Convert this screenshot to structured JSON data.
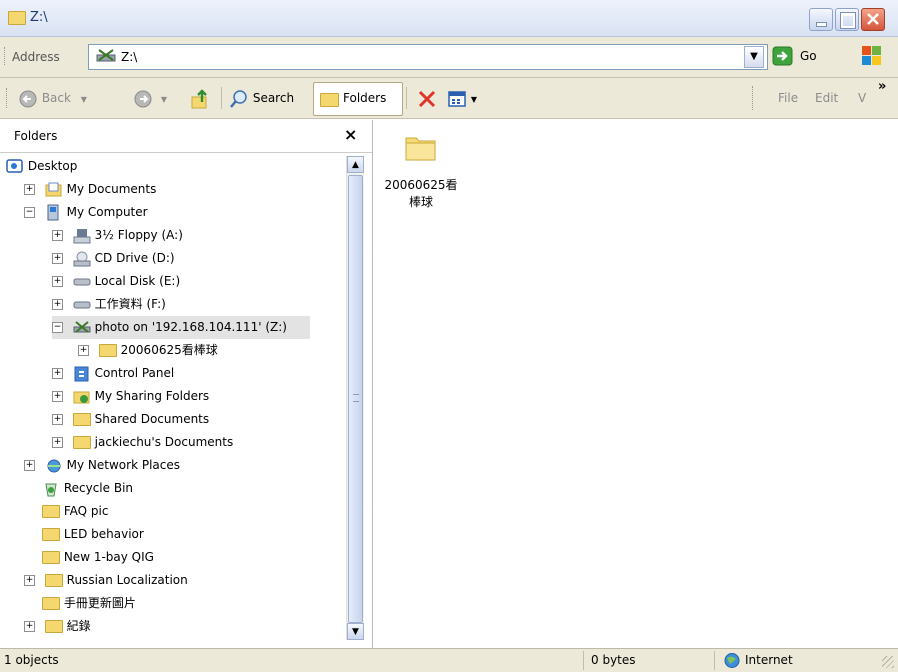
{
  "window": {
    "title": "Z:\\"
  },
  "address": {
    "label": "Address",
    "value": "Z:\\",
    "go_label": "Go"
  },
  "toolbar": {
    "back_label": "Back",
    "search_label": "Search",
    "folders_label": "Folders",
    "menu_file": "File",
    "menu_edit": "Edit",
    "menu_view": "V",
    "more_glyph": "»"
  },
  "folders_pane": {
    "title": "Folders",
    "close_glyph": "×",
    "items": [
      {
        "label": "Desktop",
        "icon": "desktop-icon"
      },
      {
        "label": "My Documents",
        "icon": "my-documents-icon",
        "expander": "+"
      },
      {
        "label": "My Computer",
        "icon": "my-computer-icon",
        "expander": "−"
      },
      {
        "label": "3½ Floppy (A:)",
        "icon": "floppy-icon",
        "expander": "+"
      },
      {
        "label": "CD Drive (D:)",
        "icon": "cd-drive-icon",
        "expander": "+"
      },
      {
        "label": "Local Disk (E:)",
        "icon": "hard-disk-icon",
        "expander": "+"
      },
      {
        "label": "工作資料 (F:)",
        "icon": "hard-disk-icon",
        "expander": "+"
      },
      {
        "label": "photo on '192.168.104.111' (Z:)",
        "icon": "network-drive-icon",
        "expander": "−"
      },
      {
        "label": "20060625看棒球",
        "icon": "folder-icon",
        "expander": "+"
      },
      {
        "label": "Control Panel",
        "icon": "control-panel-icon",
        "expander": "+"
      },
      {
        "label": "My Sharing Folders",
        "icon": "sharing-folders-icon",
        "expander": "+"
      },
      {
        "label": "Shared Documents",
        "icon": "folder-icon",
        "expander": "+"
      },
      {
        "label": "jackiechu's Documents",
        "icon": "folder-icon",
        "expander": "+"
      },
      {
        "label": "My Network Places",
        "icon": "network-places-icon",
        "expander": "+"
      },
      {
        "label": "Recycle Bin",
        "icon": "recycle-bin-icon"
      },
      {
        "label": "FAQ pic",
        "icon": "folder-icon"
      },
      {
        "label": "LED behavior",
        "icon": "folder-icon"
      },
      {
        "label": "New 1-bay QIG",
        "icon": "folder-icon"
      },
      {
        "label": "Russian Localization",
        "icon": "folder-icon",
        "expander": "+"
      },
      {
        "label": "手冊更新圖片",
        "icon": "folder-icon"
      },
      {
        "label": "紀錄",
        "icon": "folder-icon",
        "expander": "+"
      }
    ]
  },
  "content": {
    "items": [
      {
        "name_line1": "20060625看",
        "name_line2": "棒球",
        "icon": "folder-icon"
      }
    ]
  },
  "status": {
    "objects": "1 objects",
    "size": "0 bytes",
    "zone": "Internet"
  }
}
